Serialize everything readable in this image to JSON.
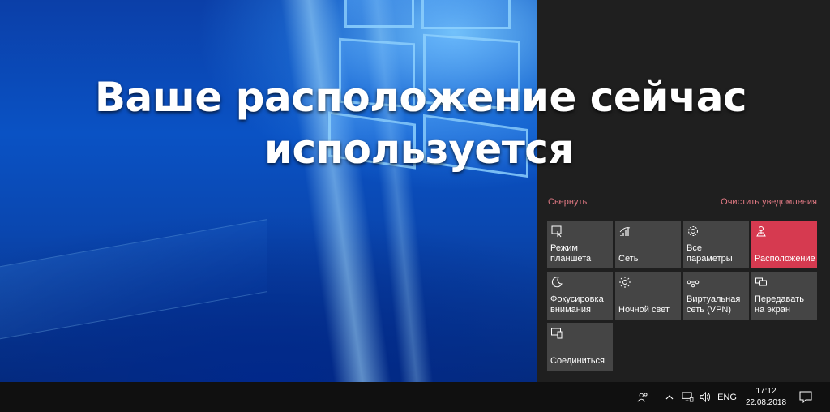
{
  "headline": {
    "line1": "Ваше расположение  сейчас",
    "line2": "используется"
  },
  "action_center": {
    "collapse_label": "Свернуть",
    "clear_label": "Очистить уведомления",
    "accent_color": "#d63a50",
    "tiles": [
      {
        "label": "Режим планшета",
        "icon": "tablet-mode-icon",
        "active": false
      },
      {
        "label": "Сеть",
        "icon": "network-icon",
        "active": false
      },
      {
        "label": "Все параметры",
        "icon": "gear-icon",
        "active": false
      },
      {
        "label": "Расположение",
        "icon": "location-icon",
        "active": true
      },
      {
        "label": "Фокусировка внимания",
        "icon": "moon-icon",
        "active": false
      },
      {
        "label": "Ночной свет",
        "icon": "brightness-icon",
        "active": false
      },
      {
        "label": "Виртуальная сеть (VPN)",
        "icon": "vpn-icon",
        "active": false
      },
      {
        "label": "Передавать на экран",
        "icon": "project-icon",
        "active": false
      },
      {
        "label": "Соединиться",
        "icon": "connect-icon",
        "active": false
      }
    ]
  },
  "taskbar": {
    "language": "ENG",
    "time": "17:12",
    "date": "22.08.2018",
    "tray_icons": [
      "people-icon",
      "chevron-up-icon",
      "network-tray-icon",
      "volume-icon",
      "notifications-icon"
    ]
  }
}
